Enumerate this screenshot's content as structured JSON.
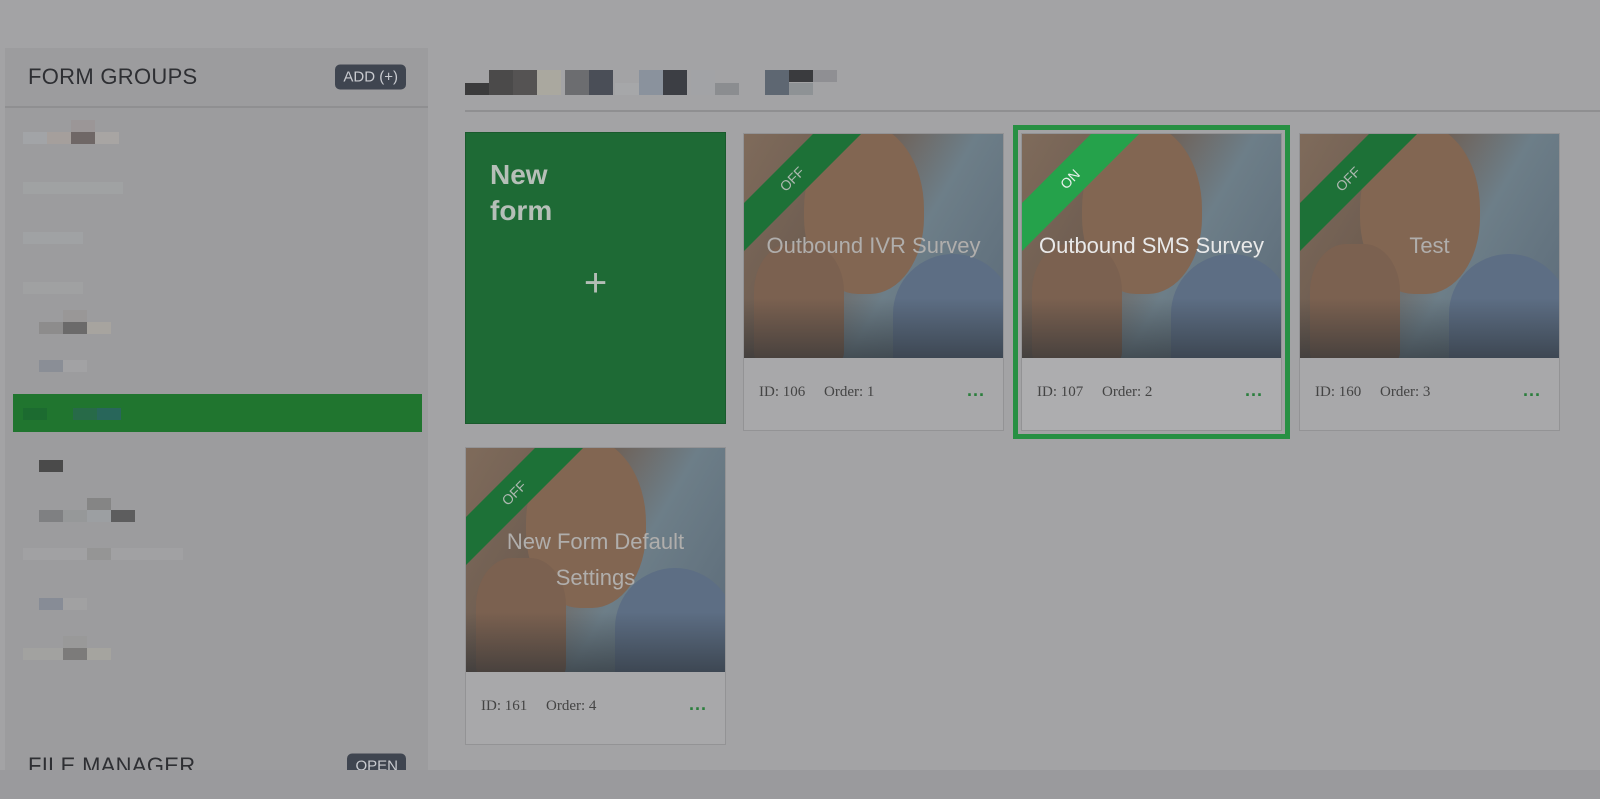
{
  "sidebar": {
    "form_groups_title": "FORM GROUPS",
    "add_button": "ADD (+)",
    "file_manager_title": "FILE MANAGER",
    "open_button": "OPEN"
  },
  "colors": {
    "accent": "#279043",
    "selected_group": "#20752f",
    "new_form_bg": "#1e6a35"
  },
  "new_form": {
    "label": "New\nform",
    "plus": "+"
  },
  "forms": [
    {
      "name": "Outbound IVR Survey",
      "status": "OFF",
      "id": "ID: 106",
      "order": "Order: 1",
      "more": "...",
      "active": false
    },
    {
      "name": "Outbound SMS Survey",
      "status": "ON",
      "id": "ID: 107",
      "order": "Order: 2",
      "more": "...",
      "active": true
    },
    {
      "name": "Test",
      "status": "OFF",
      "id": "ID: 160",
      "order": "Order: 3",
      "more": "...",
      "active": false
    },
    {
      "name": "New Form Default Settings",
      "status": "OFF",
      "id": "ID: 161",
      "order": "Order: 4",
      "more": "...",
      "active": false
    }
  ]
}
